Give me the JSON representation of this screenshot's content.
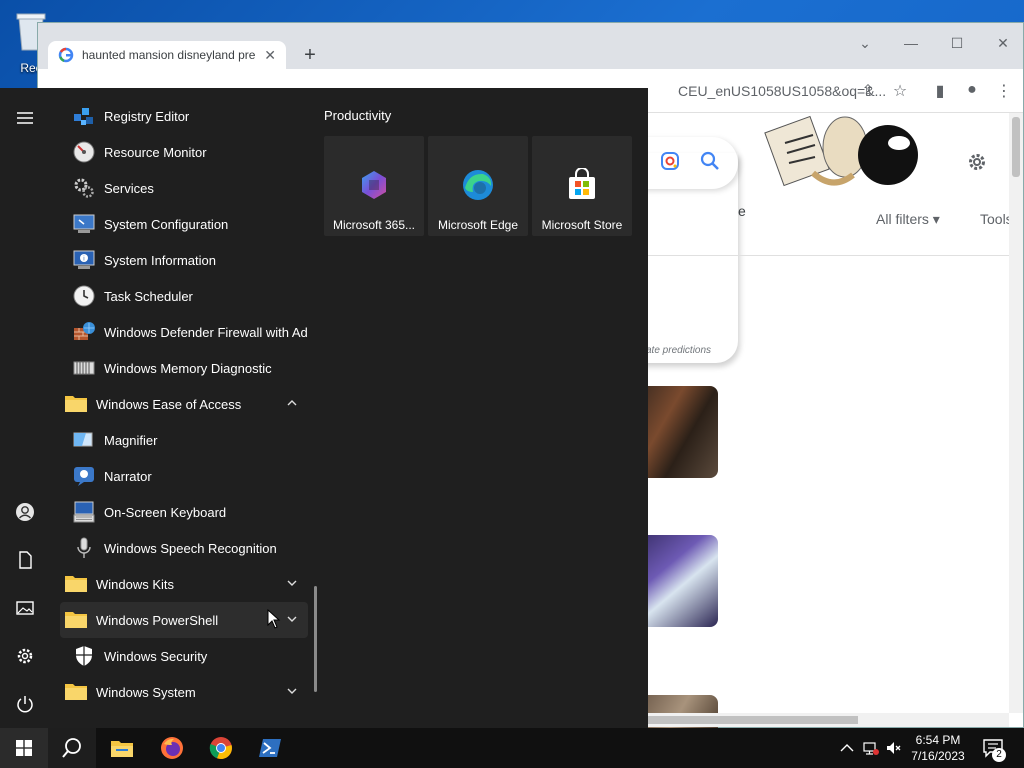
{
  "desktop": {
    "recycle_label": "Rec"
  },
  "browser": {
    "tab_title": "haunted mansion disneyland pre",
    "url_fragment": "CEU_enUS1058US1058&oq=&...",
    "new_tab_label": "+",
    "predictions_text": "ate predictions",
    "chip_partial": "e",
    "all_filters_label": "All filters",
    "tools_label": "Tools"
  },
  "start_menu": {
    "apps": [
      {
        "name": "Registry Editor",
        "icon": "registry-editor-icon",
        "type": "app"
      },
      {
        "name": "Resource Monitor",
        "icon": "resource-monitor-icon",
        "type": "app"
      },
      {
        "name": "Services",
        "icon": "services-icon",
        "type": "app"
      },
      {
        "name": "System Configuration",
        "icon": "system-configuration-icon",
        "type": "app"
      },
      {
        "name": "System Information",
        "icon": "system-information-icon",
        "type": "app"
      },
      {
        "name": "Task Scheduler",
        "icon": "task-scheduler-icon",
        "type": "app"
      },
      {
        "name": "Windows Defender Firewall with Ad...",
        "icon": "firewall-icon",
        "type": "app"
      },
      {
        "name": "Windows Memory Diagnostic",
        "icon": "memory-diagnostic-icon",
        "type": "app"
      },
      {
        "name": "Windows Ease of Access",
        "icon": "folder-icon",
        "type": "folder",
        "expanded": true
      },
      {
        "name": "Magnifier",
        "icon": "magnifier-icon",
        "type": "app"
      },
      {
        "name": "Narrator",
        "icon": "narrator-icon",
        "type": "app"
      },
      {
        "name": "On-Screen Keyboard",
        "icon": "keyboard-icon",
        "type": "app"
      },
      {
        "name": "Windows Speech Recognition",
        "icon": "microphone-icon",
        "type": "app"
      },
      {
        "name": "Windows Kits",
        "icon": "folder-icon",
        "type": "folder",
        "expanded": false
      },
      {
        "name": "Windows PowerShell",
        "icon": "folder-icon",
        "type": "folder",
        "expanded": false
      },
      {
        "name": "Windows Security",
        "icon": "shield-icon",
        "type": "app"
      },
      {
        "name": "Windows System",
        "icon": "folder-icon",
        "type": "folder",
        "expanded": false
      }
    ],
    "group_title": "Productivity",
    "tiles": [
      {
        "name": "Microsoft 365...",
        "icon": "microsoft-365-icon"
      },
      {
        "name": "Microsoft Edge",
        "icon": "edge-icon"
      },
      {
        "name": "Microsoft Store",
        "icon": "store-icon"
      }
    ]
  },
  "taskbar": {
    "time": "6:54 PM",
    "date": "7/16/2023",
    "notification_count": "2"
  },
  "colors": {
    "start_bg": "#1f1f1f",
    "tile_bg": "#2b2b2b",
    "taskbar_bg": "#101010",
    "folder_yellow": "#f4c542",
    "accent_blue": "#1a73e8"
  }
}
